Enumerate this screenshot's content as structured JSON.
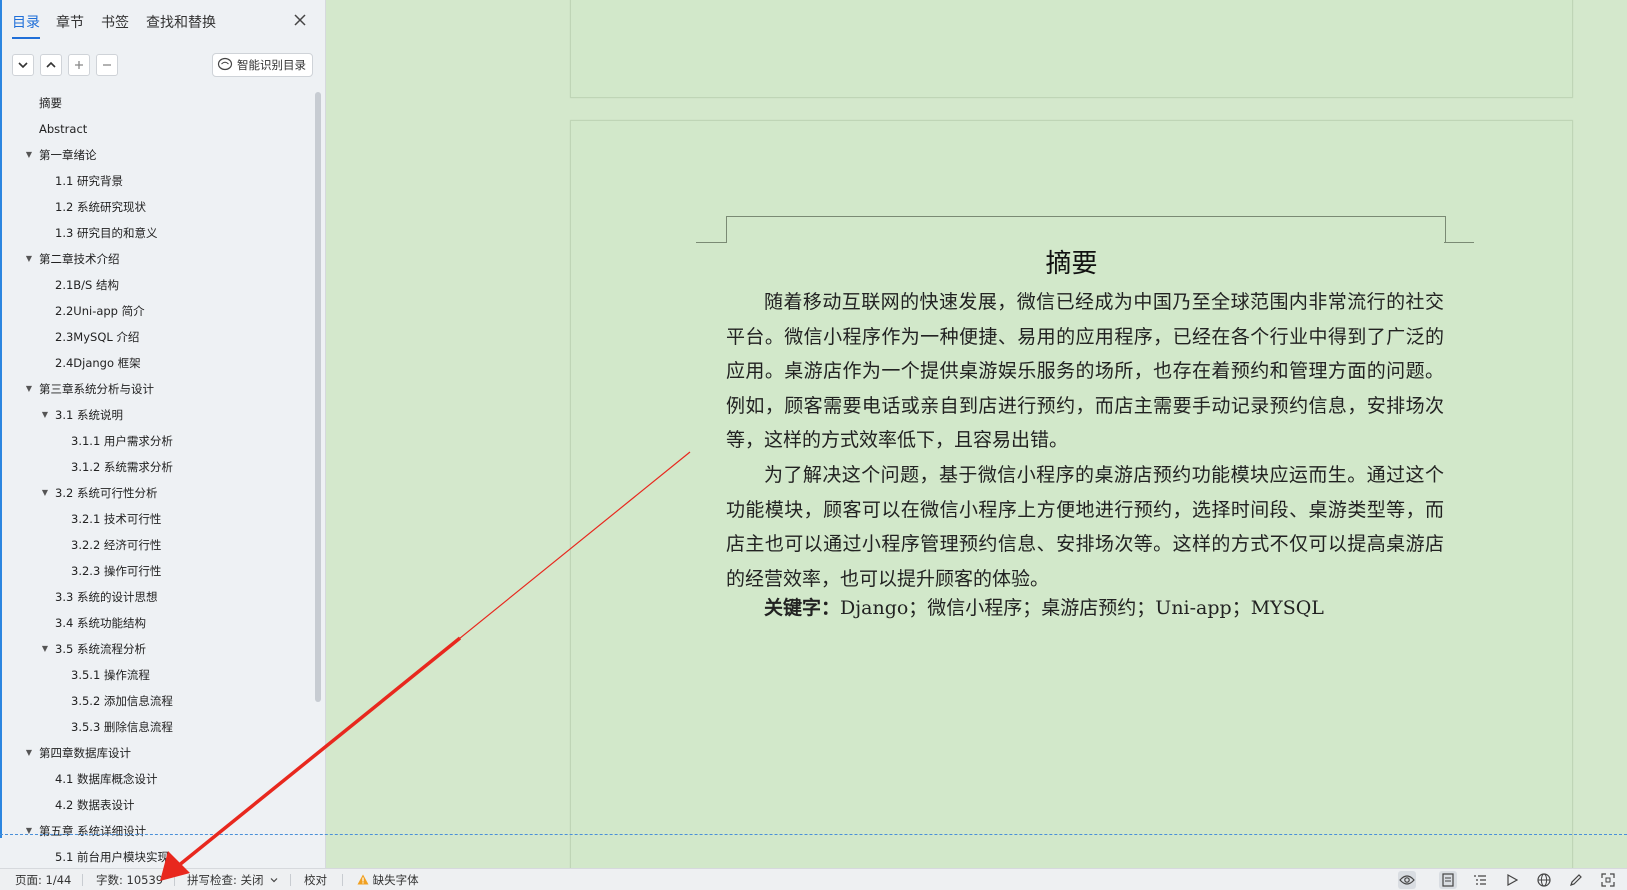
{
  "sidebar": {
    "tabs": [
      {
        "label": "目录",
        "active": true
      },
      {
        "label": "章节",
        "active": false
      },
      {
        "label": "书签",
        "active": false
      },
      {
        "label": "查找和替换",
        "active": false
      }
    ],
    "smart_toc_label": "智能识别目录",
    "toc": [
      {
        "label": "摘要",
        "level": 0,
        "caret": false
      },
      {
        "label": "Abstract",
        "level": 0,
        "caret": false
      },
      {
        "label": "第一章绪论",
        "level": 0,
        "caret": true
      },
      {
        "label": "1.1    研究背景",
        "level": 1,
        "caret": false
      },
      {
        "label": "1.2    系统研究现状",
        "level": 1,
        "caret": false
      },
      {
        "label": "1.3    研究目的和意义",
        "level": 1,
        "caret": false
      },
      {
        "label": "第二章技术介绍",
        "level": 0,
        "caret": true
      },
      {
        "label": "2.1B/S 结构",
        "level": 1,
        "caret": false
      },
      {
        "label": "2.2Uni-app 简介",
        "level": 1,
        "caret": false
      },
      {
        "label": "2.3MySQL 介绍",
        "level": 1,
        "caret": false
      },
      {
        "label": "2.4Django 框架",
        "level": 1,
        "caret": false
      },
      {
        "label": "第三章系统分析与设计",
        "level": 0,
        "caret": true
      },
      {
        "label": "3.1 系统说明",
        "level": 1,
        "caret": true
      },
      {
        "label": "3.1.1    用户需求分析",
        "level": 2,
        "caret": false
      },
      {
        "label": "3.1.2    系统需求分析",
        "level": 2,
        "caret": false
      },
      {
        "label": "3.2 系统可行性分析",
        "level": 1,
        "caret": true
      },
      {
        "label": "3.2.1  技术可行性",
        "level": 2,
        "caret": false
      },
      {
        "label": "3.2.2  经济可行性",
        "level": 2,
        "caret": false
      },
      {
        "label": "3.2.3  操作可行性",
        "level": 2,
        "caret": false
      },
      {
        "label": "3.3 系统的设计思想",
        "level": 1,
        "caret": false
      },
      {
        "label": "3.4 系统功能结构",
        "level": 1,
        "caret": false
      },
      {
        "label": "3.5 系统流程分析",
        "level": 1,
        "caret": true
      },
      {
        "label": "3.5.1 操作流程",
        "level": 2,
        "caret": false
      },
      {
        "label": "3.5.2 添加信息流程",
        "level": 2,
        "caret": false
      },
      {
        "label": "3.5.3 删除信息流程",
        "level": 2,
        "caret": false
      },
      {
        "label": "第四章数据库设计",
        "level": 0,
        "caret": true
      },
      {
        "label": "4.1 数据库概念设计",
        "level": 1,
        "caret": false
      },
      {
        "label": "4.2 数据表设计",
        "level": 1,
        "caret": false
      },
      {
        "label": "第五章  系统详细设计",
        "level": 0,
        "caret": true
      },
      {
        "label": "5.1 前台用户模块实现",
        "level": 1,
        "caret": false
      }
    ]
  },
  "document": {
    "abstract_title": "摘要",
    "paragraph_1": "随着移动互联网的快速发展，微信已经成为中国乃至全球范围内非常流行的社交平台。微信小程序作为一种便捷、易用的应用程序，已经在各个行业中得到了广泛的应用。桌游店作为一个提供桌游娱乐服务的场所，也存在着预约和管理方面的问题。例如，顾客需要电话或亲自到店进行预约，而店主需要手动记录预约信息，安排场次等，这样的方式效率低下，且容易出错。",
    "paragraph_2": "为了解决这个问题，基于微信小程序的桌游店预约功能模块应运而生。通过这个功能模块，顾客可以在微信小程序上方便地进行预约，选择时间段、桌游类型等，而店主也可以通过小程序管理预约信息、安排场次等。这样的方式不仅可以提高桌游店的经营效率，也可以提升顾客的体验。",
    "keywords_label": "关键字：",
    "keywords_text": "Django；微信小程序；桌游店预约；Uni-app；MYSQL"
  },
  "statusbar": {
    "page": "页面: 1/44",
    "word_count": "字数: 10539",
    "spell_check": "拼写检查: 关闭",
    "proofread": "校对",
    "missing_font": "缺失字体"
  },
  "colors": {
    "accent": "#1f6fd8",
    "doc_background": "#d4e8cc",
    "annotation_red": "#e8281e"
  }
}
